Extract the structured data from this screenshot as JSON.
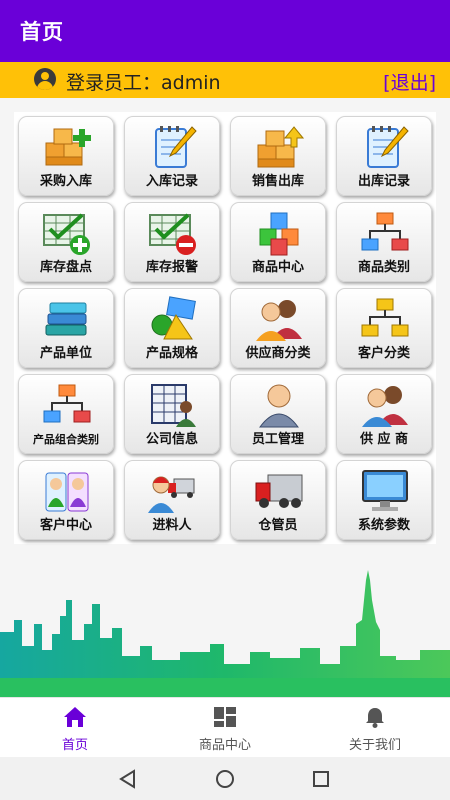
{
  "appbar": {
    "title": "首页"
  },
  "user_bar": {
    "login_text": "登录员工：admin",
    "logout_label": "[退出]"
  },
  "grid": {
    "tiles": [
      {
        "label": "采购入库",
        "icon": "boxes-add-icon"
      },
      {
        "label": "入库记录",
        "icon": "notepad-icon"
      },
      {
        "label": "销售出库",
        "icon": "boxes-up-icon"
      },
      {
        "label": "出库记录",
        "icon": "notepad-icon"
      },
      {
        "label": "库存盘点",
        "icon": "spreadsheet-add-icon"
      },
      {
        "label": "库存报警",
        "icon": "spreadsheet-remove-icon"
      },
      {
        "label": "商品中心",
        "icon": "cubes-icon"
      },
      {
        "label": "商品类别",
        "icon": "hierarchy-icon"
      },
      {
        "label": "产品单位",
        "icon": "books-icon"
      },
      {
        "label": "产品规格",
        "icon": "shapes-icon"
      },
      {
        "label": "供应商分类",
        "icon": "users-icon"
      },
      {
        "label": "客户分类",
        "icon": "hierarchy-icon"
      },
      {
        "label": "产品组合类别",
        "icon": "hierarchy-icon"
      },
      {
        "label": "公司信息",
        "icon": "company-info-icon"
      },
      {
        "label": "员工管理",
        "icon": "employee-icon"
      },
      {
        "label": "供 应 商",
        "icon": "users-icon"
      },
      {
        "label": "客户中心",
        "icon": "customers-icon"
      },
      {
        "label": "进料人",
        "icon": "courier-truck-icon"
      },
      {
        "label": "仓管员",
        "icon": "truck-icon"
      },
      {
        "label": "系统参数",
        "icon": "monitor-icon"
      }
    ]
  },
  "bottom_nav": {
    "items": [
      {
        "label": "首页",
        "icon": "home-icon",
        "active": true
      },
      {
        "label": "商品中心",
        "icon": "dashboard-icon",
        "active": false
      },
      {
        "label": "关于我们",
        "icon": "bell-icon",
        "active": false
      }
    ]
  },
  "colors": {
    "primary": "#6a00d8",
    "user_bar": "#ffc107",
    "skyline_green": "#1fb86a"
  }
}
